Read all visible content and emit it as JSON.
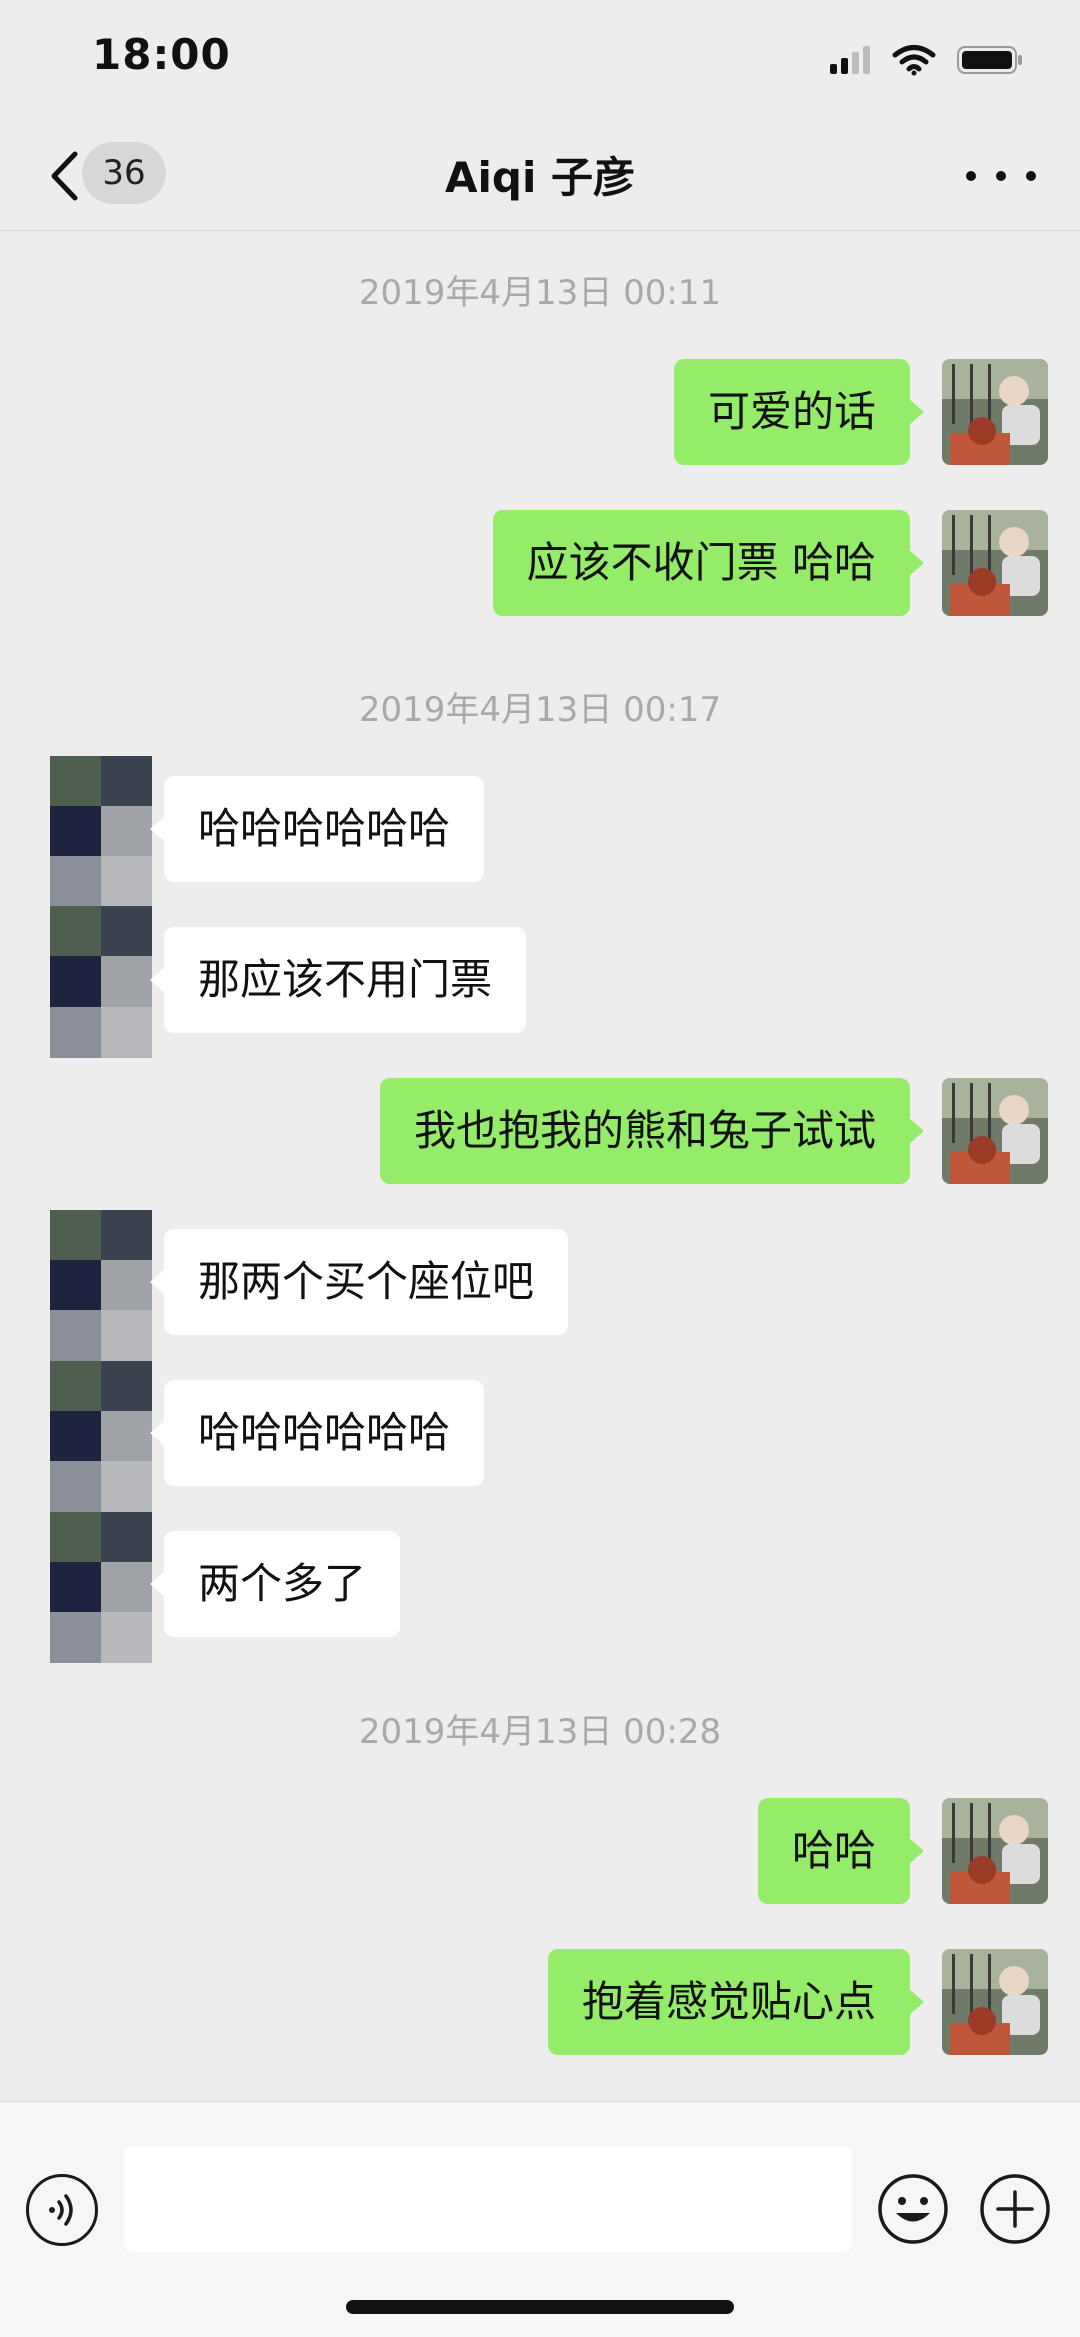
{
  "status_bar": {
    "time": "18:00",
    "icons": [
      "signal-icon",
      "wifi-icon",
      "battery-icon"
    ]
  },
  "header": {
    "back_icon": "chevron-left-icon",
    "unread_count": "36",
    "title": "Aiqi 子彦",
    "more_icon": "more-dots-icon"
  },
  "timestamps": [
    "2019年4月13日 00:11",
    "2019年4月13日 00:17",
    "2019年4月13日 00:28"
  ],
  "messages": [
    {
      "from": "me",
      "text": "可爱的话"
    },
    {
      "from": "me",
      "text": "应该不收门票 哈哈"
    },
    {
      "from": "them",
      "text": "哈哈哈哈哈哈"
    },
    {
      "from": "them",
      "text": "那应该不用门票"
    },
    {
      "from": "me",
      "text": "我也抱我的熊和兔子试试"
    },
    {
      "from": "them",
      "text": "那两个买个座位吧"
    },
    {
      "from": "them",
      "text": "哈哈哈哈哈哈"
    },
    {
      "from": "them",
      "text": "两个多了"
    },
    {
      "from": "me",
      "text": "哈哈"
    },
    {
      "from": "me",
      "text": "抱着感觉贴心点"
    }
  ],
  "input_bar": {
    "text_value": "",
    "icons": [
      "voice-icon",
      "emoji-icon",
      "plus-icon"
    ]
  },
  "colors": {
    "background": "#ededed",
    "my_bubble": "#95ec69",
    "their_bubble": "#ffffff",
    "timestamp": "#a9a9a9"
  }
}
